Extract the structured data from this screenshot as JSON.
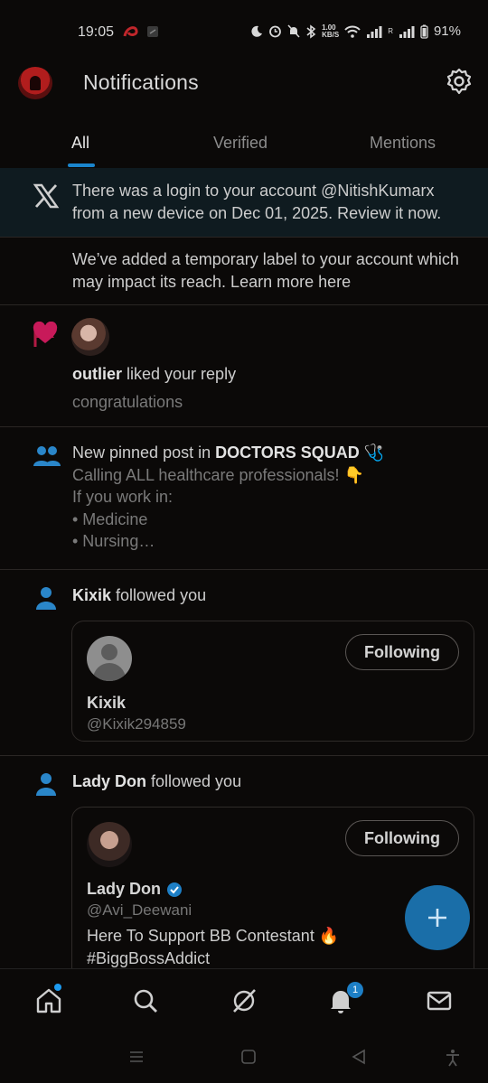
{
  "status_bar": {
    "time": "19:05",
    "network_speed": "1.00",
    "network_unit": "KB/S",
    "battery": "91%",
    "sim_label": "R"
  },
  "header": {
    "title": "Notifications"
  },
  "tabs": [
    {
      "label": "All",
      "active": true
    },
    {
      "label": "Verified",
      "active": false
    },
    {
      "label": "Mentions",
      "active": false
    }
  ],
  "notifications": {
    "login": {
      "text": "There was a login to your account @NitishKumarx from a new device on Dec 01, 2025. Review it now."
    },
    "label": {
      "text": "We’ve added a temporary label to your account which may impact its reach. Learn more here"
    },
    "like": {
      "user": "outlier",
      "action": " liked your reply",
      "reply_text": "congratulations"
    },
    "pinned": {
      "prefix": "New pinned post in ",
      "community": "DOCTORS SQUAD",
      "emoji": "🩺",
      "line1": "Calling ALL healthcare professionals! 👇",
      "line2": "If you work in:",
      "line3": "• Medicine",
      "line4": "• Nursing…"
    },
    "follow1": {
      "user": "Kixik",
      "action": " followed you",
      "card_name": "Kixik",
      "card_handle": "@Kixik294859",
      "button": "Following"
    },
    "follow2": {
      "user": "Lady Don",
      "action": " followed you",
      "card_name": "Lady Don",
      "card_handle": "@Avi_Deewani",
      "bio_line1": "Here To Support BB Contestant 🔥",
      "bio_line2": "#BiggBossAddict",
      "button": "Following"
    }
  },
  "bottom_nav": {
    "notification_badge": "1"
  },
  "colors": {
    "accent": "#1d9bf0",
    "like": "#c81a5a",
    "flag": "#b31a44",
    "people": "#2a86c9"
  }
}
